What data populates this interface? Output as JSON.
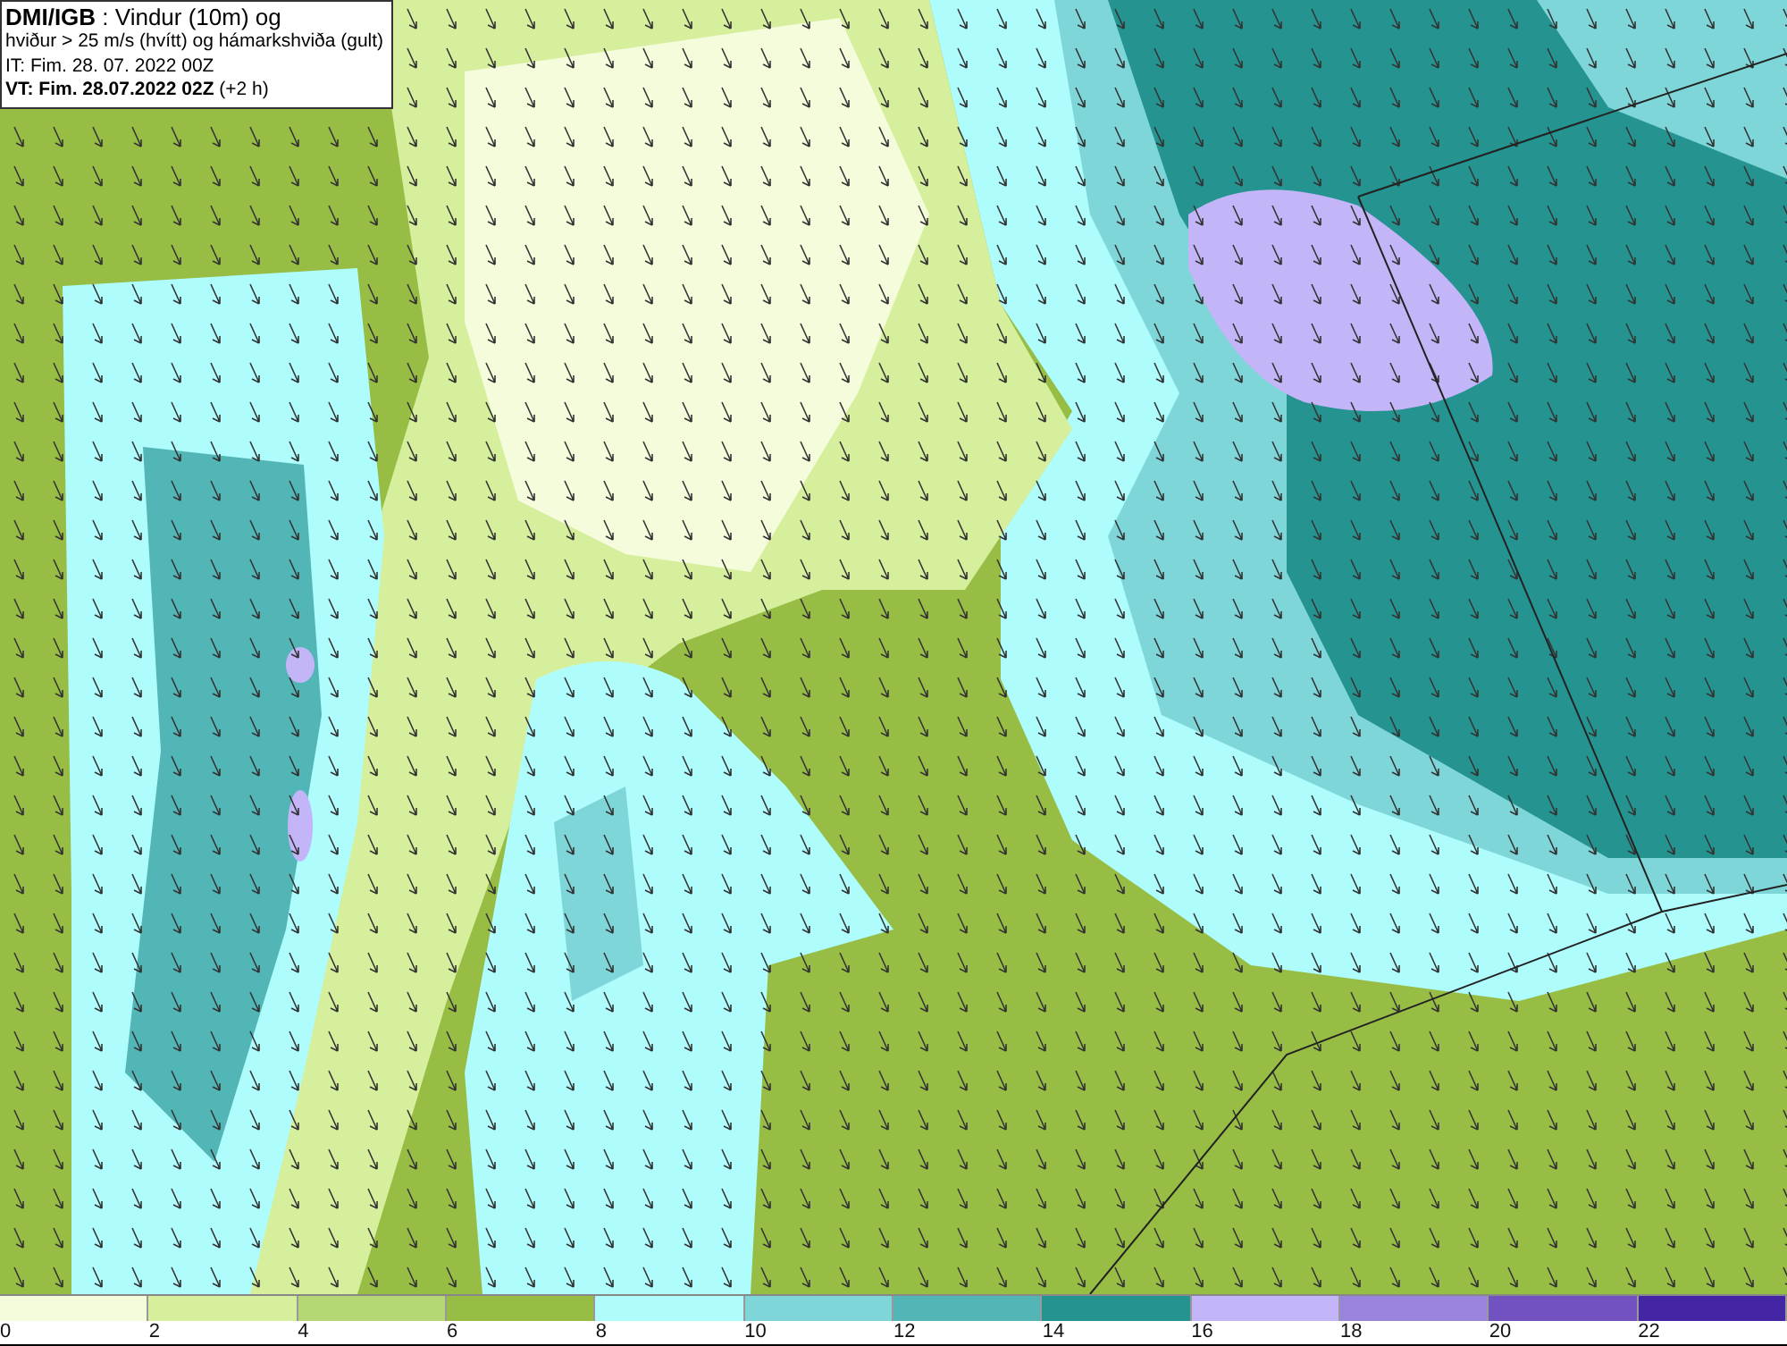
{
  "title_box": {
    "lines": [
      "**DMI/IGB** : Vindur (10m) og",
      "hviður > 25 m/s (hvítt) og hámarkshviða (gult)",
      "IT: Fim. 28. 07. 2022 00Z",
      "**VT: Fim. 28.07.2022 02Z** (+2 h)"
    ]
  },
  "legend": [
    {
      "label": "0",
      "color": "#f4fcdc"
    },
    {
      "label": "2",
      "color": "#d6ef9c"
    },
    {
      "label": "4",
      "color": "#b6d874"
    },
    {
      "label": "6",
      "color": "#97bd45"
    },
    {
      "label": "8",
      "color": "#aefcfc"
    },
    {
      "label": "10",
      "color": "#7fd6d8"
    },
    {
      "label": "12",
      "color": "#52b6b6"
    },
    {
      "label": "14",
      "color": "#259490"
    },
    {
      "label": "16",
      "color": "#c4b4f8"
    },
    {
      "label": "18",
      "color": "#9a84de"
    },
    {
      "label": "20",
      "color": "#7152c0"
    },
    {
      "label": "22",
      "color": "#4426a4"
    }
  ]
}
